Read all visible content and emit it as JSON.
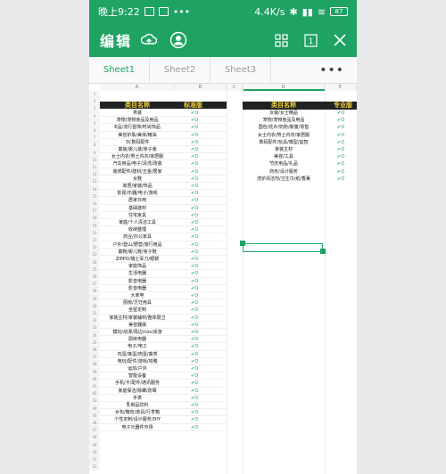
{
  "status_bar": {
    "time": "晚上9:22",
    "speed": "4.4K/s",
    "battery": "87"
  },
  "toolbar": {
    "edit_label": "编辑"
  },
  "sheet_tabs": [
    {
      "label": "Sheet1"
    },
    {
      "label": "Sheet2"
    },
    {
      "label": "Sheet3"
    }
  ],
  "more_label": "•••",
  "columns": [
    "A",
    "B",
    "C",
    "D",
    "E"
  ],
  "col_a_header": "类目名称",
  "col_b_header": "标准版",
  "col_d_header": "类目名称",
  "col_e_header": "专业版",
  "tick": "✔O",
  "rows_a": [
    "男装",
    "宠物/宠物食品及用品",
    "E品/流行首饰/时尚饰品",
    "美容护肤/美体/精油",
    "3C数码配件",
    "童装/婴儿装/亲子装",
    "女士内衣/男士内衣/家居服",
    "汽车用品/电子/清洗/改装",
    "装修配件/建材/五金/居家",
    "女鞋",
    "家居/家装/饰品",
    "影视/乐器/电子/游戏",
    "居家日用",
    "基础建材",
    "住宅家具",
    "家庭/个人清洁工具",
    "收纳整理",
    "商业/办公家具",
    "户外/登山/野营/旅行用品",
    "童鞋/婴儿鞋/亲子鞋",
    "ZIPPO/瑞士军刀/眼镜",
    "家庭饰品",
    "生活电器",
    "影音电器",
    "影音电器",
    "大家电",
    "厨房/烹饪用具",
    "全屋定制",
    "家装主材/家装辅材/整体厨卫",
    "美容器械",
    "模玩/动漫/周边/cos/桌游",
    "厨房电器",
    "电子/电工",
    "鸡蛋/禽蛋/肉蛋/禽类",
    "电玩/配件/游戏/攻略",
    "运动/户外",
    "智能设备",
    "手机/卡/配件/通讯服务",
    "家庭保洁/除螨/防霉",
    "手表",
    "乳制品饮料",
    "女包/箱包/皮具/行李箱",
    "个性定制/设计服务/DIY",
    "电子元器件市场"
  ],
  "rows_d": [
    "女装/女士精品",
    "宠物/宠物食品及用品",
    "国包/花卉/奶粉/婴童/零售",
    "女士内衣/男士内衣/家居服",
    "数码配件/玩具/模型/益智",
    "家装主材",
    "美容/工具",
    "节庆用品/礼品",
    "商务/设计服务",
    "洗护清洁剂/卫生巾/纸/香薰"
  ]
}
